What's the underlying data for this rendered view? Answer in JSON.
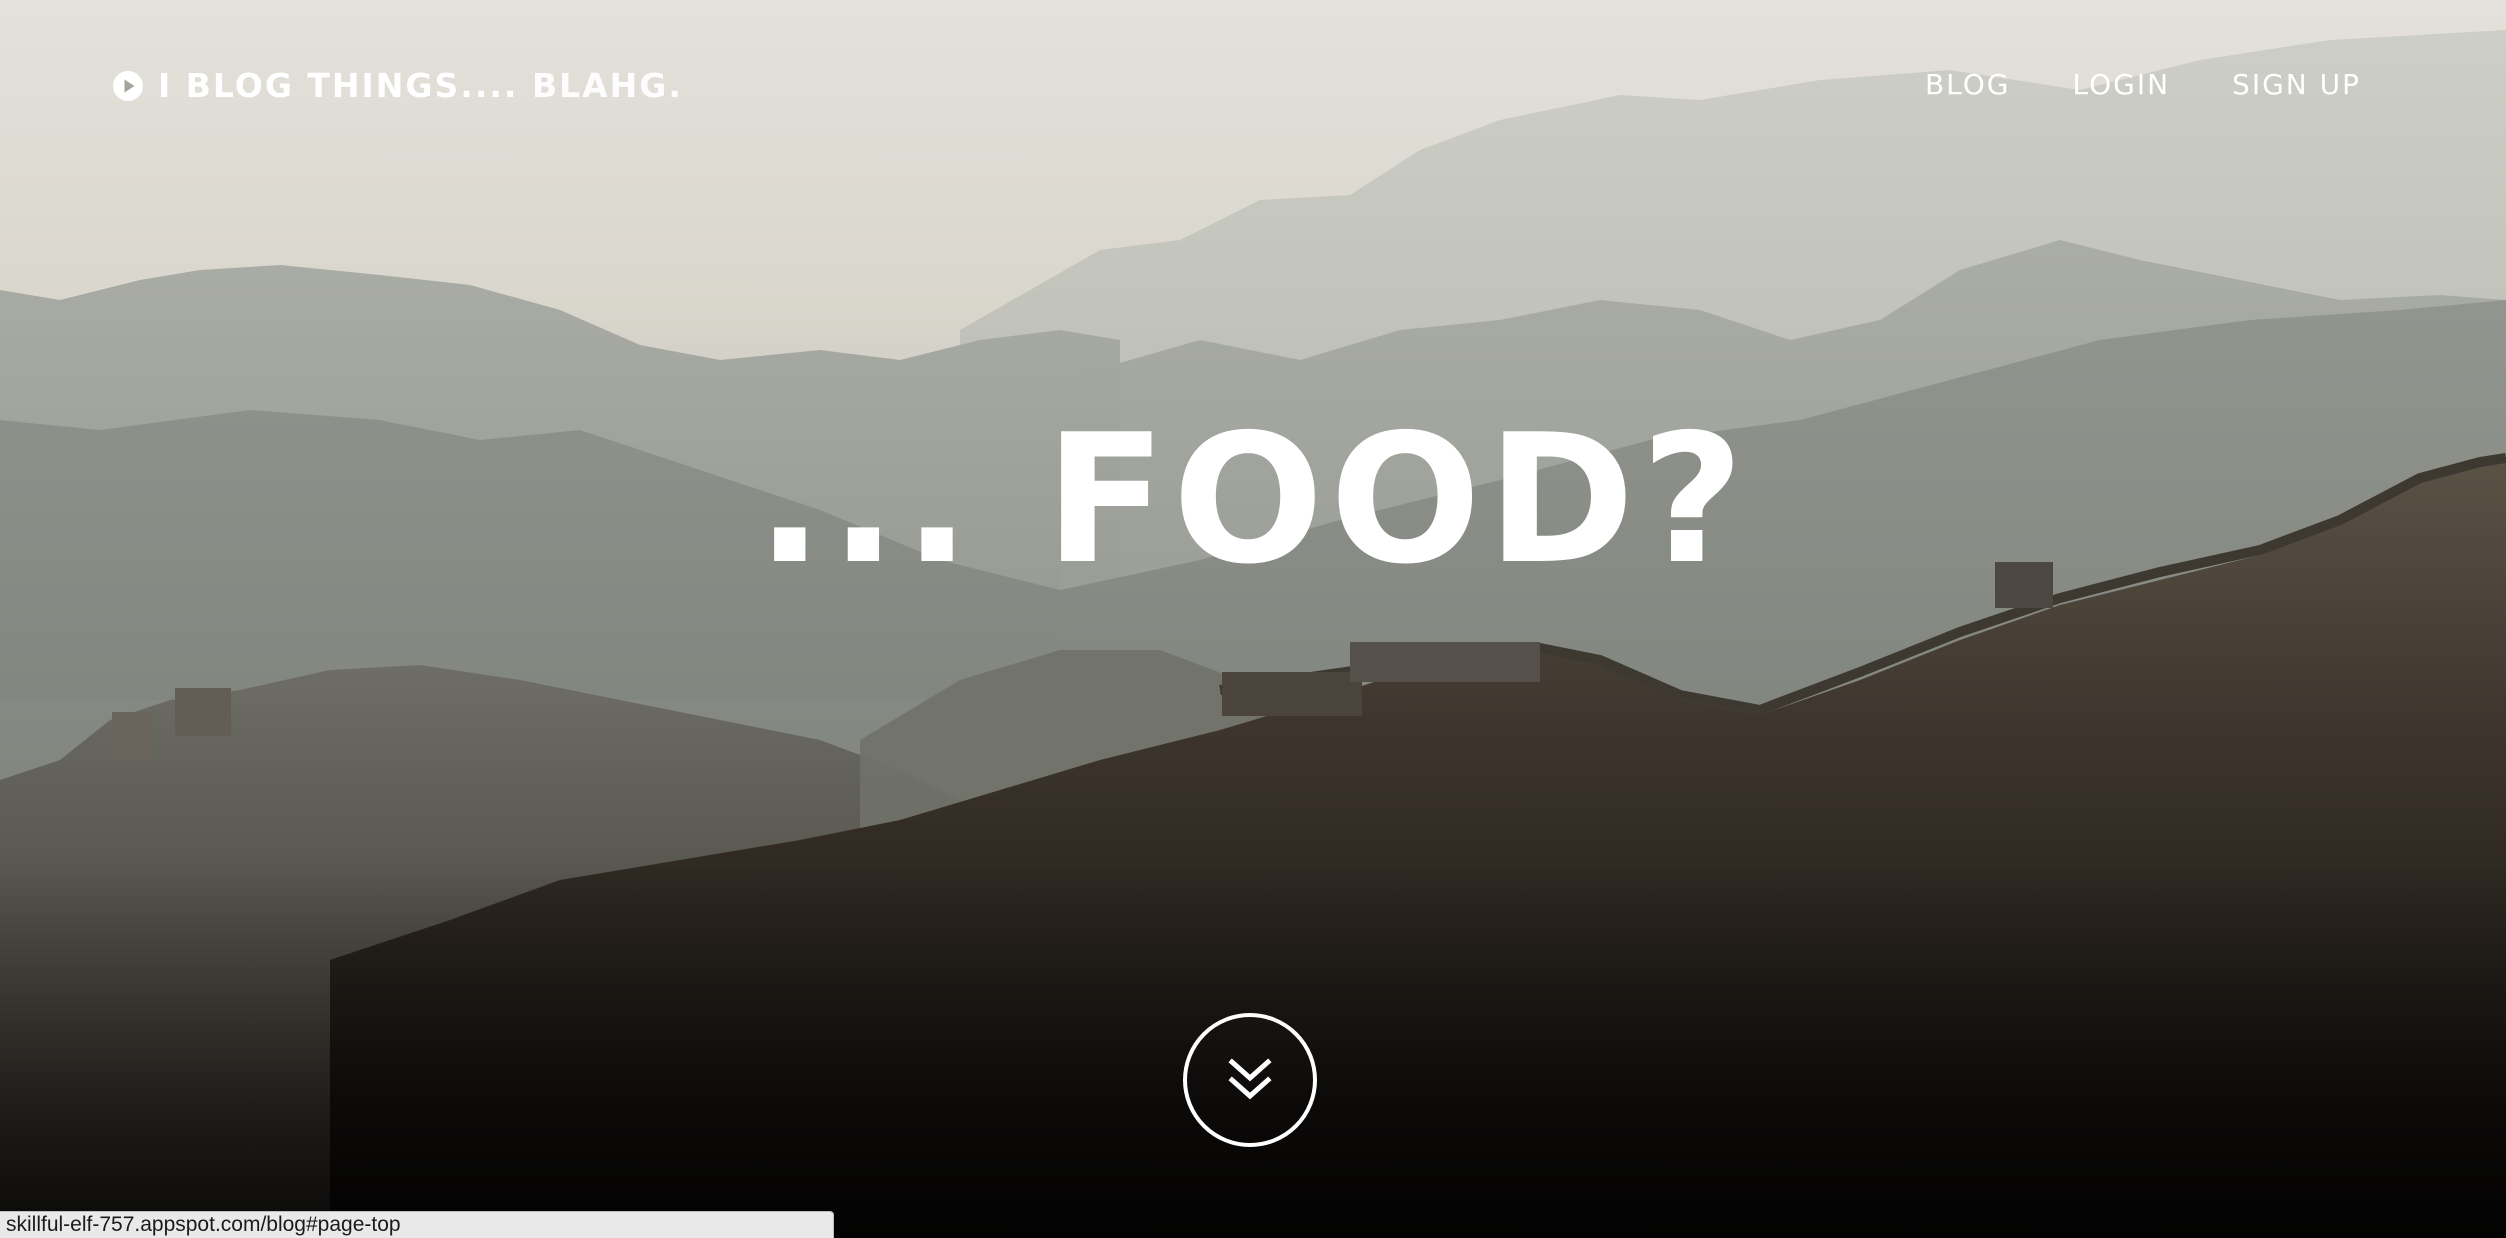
{
  "brand": {
    "icon": "play-circle-icon",
    "title_main": "I BLOG THINGS....",
    "title_suffix": "BLAHG."
  },
  "nav": {
    "items": [
      {
        "label": "BLOG"
      },
      {
        "label": "LOGIN"
      },
      {
        "label": "SIGN UP"
      }
    ]
  },
  "hero": {
    "headline": "... FOOD?",
    "background": "misty-mountains-great-wall-photo",
    "scroll_icon": "double-chevron-down-icon"
  },
  "status_bar": {
    "url": "skillful-elf-757.appspot.com/blog#page-top"
  },
  "colors": {
    "text": "#ffffff",
    "sky_top": "#e4e1dc",
    "haze": "#b9bcb4",
    "foreground_dark": "#0b0908",
    "status_bar_bg": "#e9e9e9"
  }
}
